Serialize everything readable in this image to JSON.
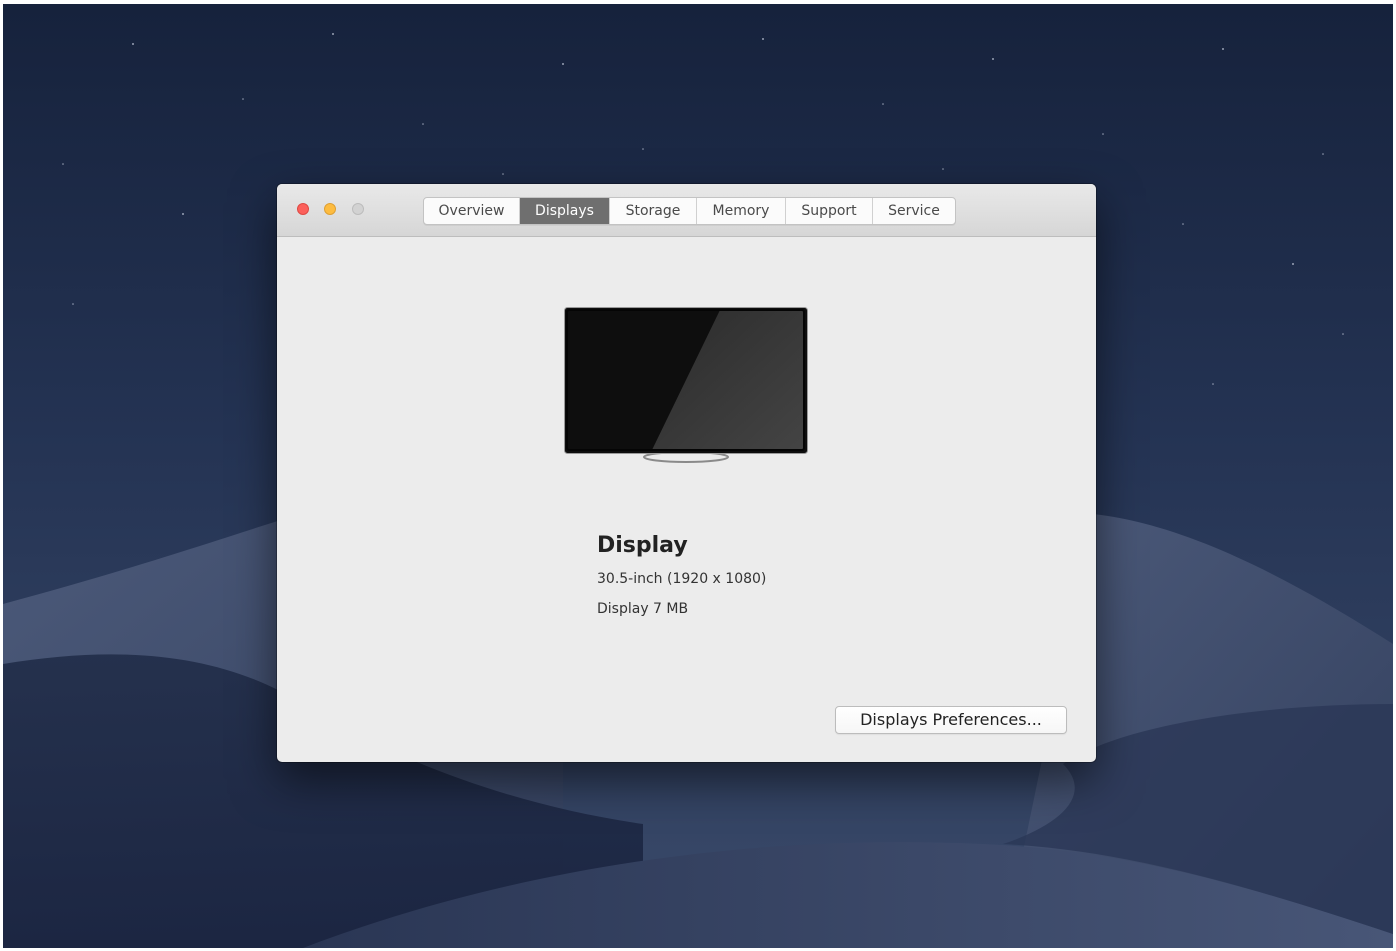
{
  "window": {
    "controls": {
      "close_icon": "close-icon",
      "minimize_icon": "minimize-icon",
      "zoom_icon": "zoom-icon"
    },
    "tabs": [
      {
        "label": "Overview",
        "active": false
      },
      {
        "label": "Displays",
        "active": true
      },
      {
        "label": "Storage",
        "active": false
      },
      {
        "label": "Memory",
        "active": false
      },
      {
        "label": "Support",
        "active": false
      },
      {
        "label": "Service",
        "active": false
      }
    ]
  },
  "display": {
    "name": "Display",
    "size_resolution": "30.5-inch (1920 x 1080)",
    "memory": "Display 7 MB",
    "preferences_button": "Displays Preferences..."
  },
  "colors": {
    "active_tab": "#6f6f6f",
    "close": "#fc605b",
    "minimize": "#fdbc40",
    "zoom": "#d2d2d2",
    "desktop_sky": "#1d2b47"
  }
}
